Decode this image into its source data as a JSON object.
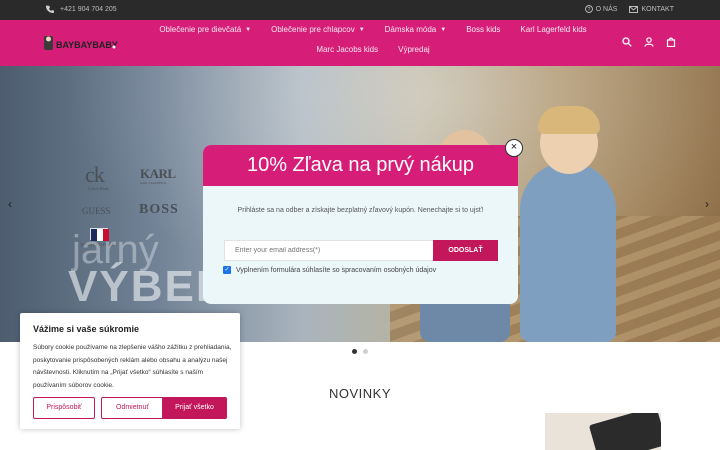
{
  "topbar": {
    "phone": "+421 904 704 205",
    "about": "O NÁS",
    "contact": "KONTAKT"
  },
  "logo": {
    "text": "BAYBAYBABY"
  },
  "nav": {
    "items": [
      {
        "label": "Oblečenie pre dievčatá",
        "has_dropdown": true
      },
      {
        "label": "Oblečenie pre chlapcov",
        "has_dropdown": true
      },
      {
        "label": "Dámska móda",
        "has_dropdown": true
      },
      {
        "label": "Boss kids",
        "has_dropdown": false
      },
      {
        "label": "Karl Lagerfeld kids",
        "has_dropdown": false
      },
      {
        "label": "Marc Jacobs kids",
        "has_dropdown": false
      },
      {
        "label": "Výpredaj",
        "has_dropdown": false
      }
    ],
    "icons": [
      "search-icon",
      "user-icon",
      "cart-icon"
    ]
  },
  "hero": {
    "brands": {
      "ck": "ck",
      "ck_sub": "Calvin Klein",
      "karl": "KARL",
      "karl_sub": "KARL LAGERFELD",
      "guess": "GUESS",
      "boss": "BOSS",
      "tommy": "TOMMY HILFIGER"
    },
    "headline_top": "jarný",
    "headline_bottom": "VÝBER",
    "prev": "‹",
    "next": "›",
    "slides": 2,
    "active_slide": 1
  },
  "section": {
    "title": "NOVINKY"
  },
  "popup": {
    "title": "10% Zľava na prvý nákup",
    "close": "×",
    "description": "Prihláste sa na odber a získajte bezplatný zľavový kupón. Nenechajte si to ujsť!",
    "email_placeholder": "Enter your email address(*)",
    "submit": "ODOSLAŤ",
    "consent": "Vyplnením formulára súhlasíte so spracovaním osobných údajov",
    "consent_checked": true
  },
  "cookie": {
    "title": "Vážime si vaše súkromie",
    "text": "Súbory cookie používame na zlepšenie vášho zážitku z prehliadania, poskytovanie prispôsobených reklám alebo obsahu a analýzu našej návštevnosti. Kliknutím na „Prijať všetko“ súhlasíte s naším používaním súborov cookie.",
    "customize": "Prispôsobiť",
    "reject": "Odmietnuť",
    "accept": "Prijať všetko"
  },
  "colors": {
    "brand": "#d61e79",
    "accent": "#c2185b",
    "topbar": "#2a2a2a"
  }
}
